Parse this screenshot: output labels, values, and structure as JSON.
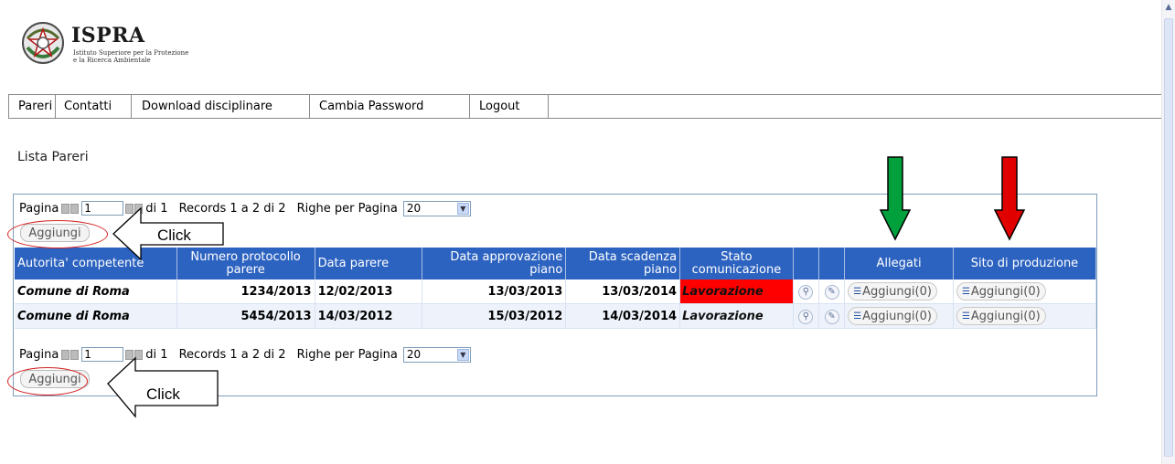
{
  "header": {
    "brand": "ISPRA",
    "subtitle_line1": "Istituto Superiore per la Protezione",
    "subtitle_line2": "e la Ricerca Ambientale"
  },
  "nav": {
    "items": [
      "Pareri",
      "Contatti",
      "Download disciplinare",
      "Cambia Password",
      "Logout"
    ]
  },
  "page_title": "Lista Pareri",
  "pager": {
    "label_page": "Pagina",
    "page_value": "1",
    "of_total": "di 1",
    "records": "Records 1 a 2 di 2",
    "rows_label": "Righe per Pagina",
    "rows_value": "20"
  },
  "add_button_label": "Aggiungi",
  "table": {
    "headers": [
      "Autorita' competente",
      "Numero protocollo parere",
      "Data parere",
      "Data approvazione piano",
      "Data scadenza piano",
      "Stato comunicazione",
      "",
      "",
      "Allegati",
      "Sito di produzione"
    ],
    "rows": [
      {
        "ente": "Comune di Roma",
        "protocollo": "1234/2013",
        "data_parere": "12/02/2013",
        "data_approvazione": "13/03/2013",
        "data_scadenza": "13/03/2014",
        "stato": "Lavorazione",
        "allegati": "Aggiungi(0)",
        "sito": "Aggiungi(0)"
      },
      {
        "ente": "Comune di Roma",
        "protocollo": "5454/2013",
        "data_parere": "14/03/2012",
        "data_approvazione": "15/03/2012",
        "data_scadenza": "14/03/2014",
        "stato": "Lavorazione",
        "allegati": "Aggiungi(0)",
        "sito": "Aggiungi(0)"
      }
    ]
  },
  "annotations": {
    "click_label": "Click",
    "green_arrow_color": "#00a03c",
    "red_arrow_color": "#e00000",
    "ellipse_color": "#d32020"
  },
  "icons": {
    "view": "magnifier-icon",
    "edit": "edit-icon",
    "tree": "tree-icon"
  }
}
